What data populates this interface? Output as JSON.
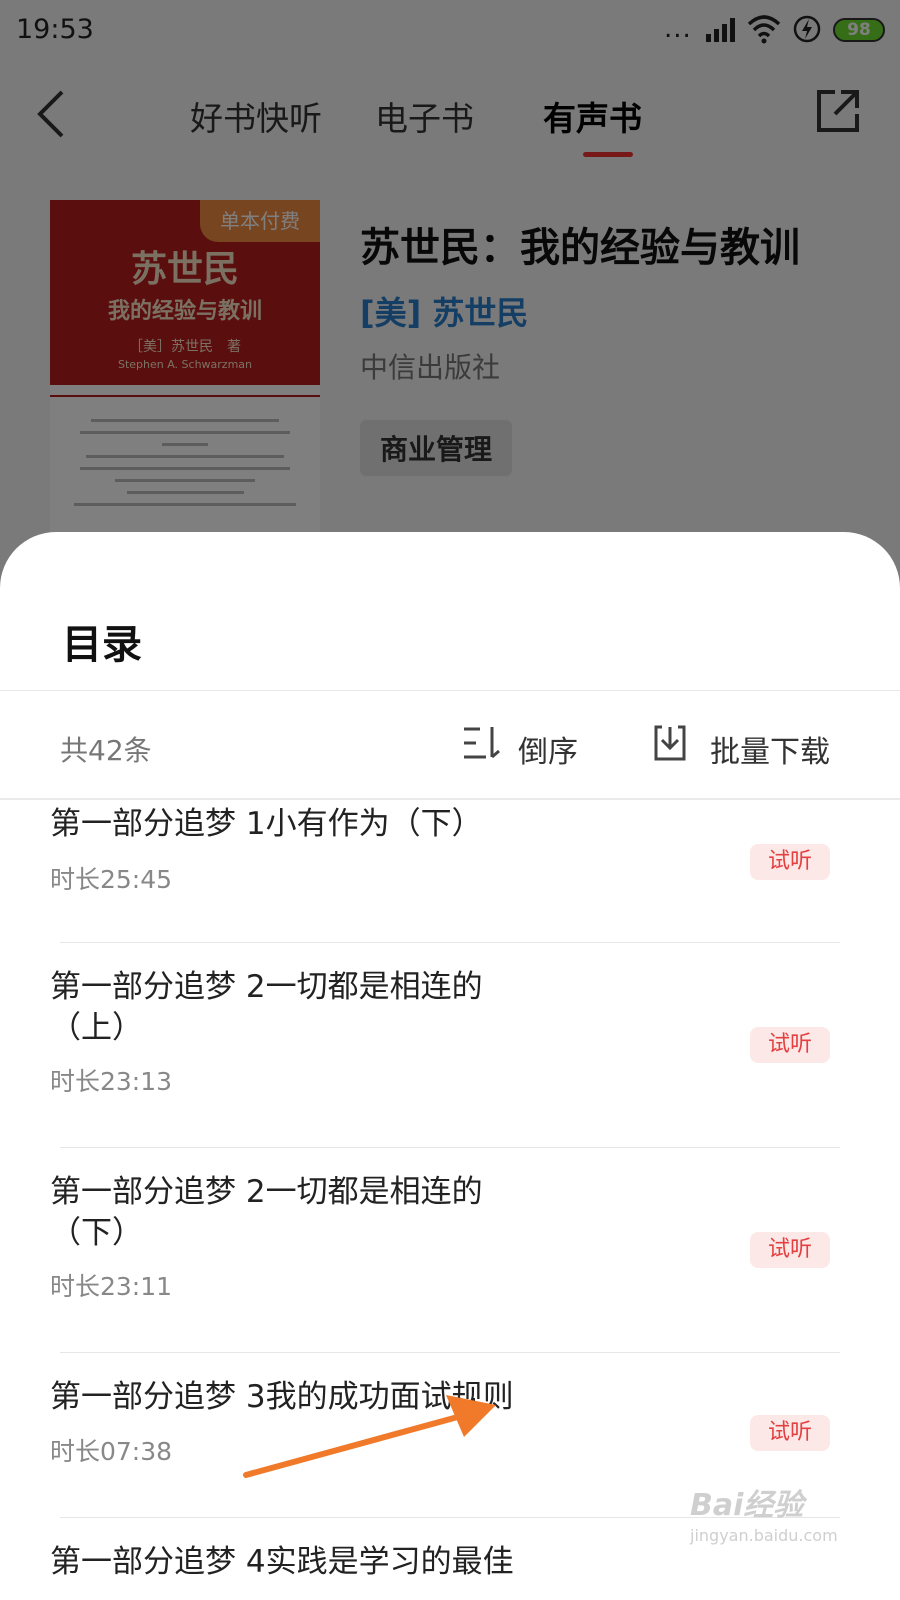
{
  "status_bar": {
    "time": "19:53",
    "battery": "98",
    "dots": "..."
  },
  "header": {
    "tabs": [
      {
        "label": "好书快听",
        "active": false
      },
      {
        "label": "电子书",
        "active": false
      },
      {
        "label": "有声书",
        "active": true
      }
    ],
    "accent_color": "#e33333"
  },
  "book": {
    "cover": {
      "badge": "单本付费",
      "title": "苏世民",
      "subtitle": "我的经验与教训",
      "author": "［美］苏世民　著",
      "author_en": "Stephen A. Schwarzman"
    },
    "title": "苏世民：我的经验与教训",
    "author": "[美] 苏世民",
    "publisher": "中信出版社",
    "tag": "商业管理"
  },
  "toc": {
    "title": "目录",
    "count": "共42条",
    "sort_label": "倒序",
    "download_label": "批量下载",
    "chapters": [
      {
        "title": "第一部分追梦 1小有作为（下）",
        "duration": "时长25:45",
        "badge": "试听"
      },
      {
        "title": "第一部分追梦 2一切都是相连的（上）",
        "duration": "时长23:13",
        "badge": "试听"
      },
      {
        "title": "第一部分追梦 2一切都是相连的（下）",
        "duration": "时长23:11",
        "badge": "试听"
      },
      {
        "title": "第一部分追梦 3我的成功面试规则",
        "duration": "时长07:38",
        "badge": "试听"
      },
      {
        "title": "第一部分追梦 4实践是学习的最佳",
        "duration": "",
        "badge": ""
      }
    ]
  },
  "watermark": {
    "main": "Bai经验",
    "sub": "jingyan.baidu.com"
  }
}
